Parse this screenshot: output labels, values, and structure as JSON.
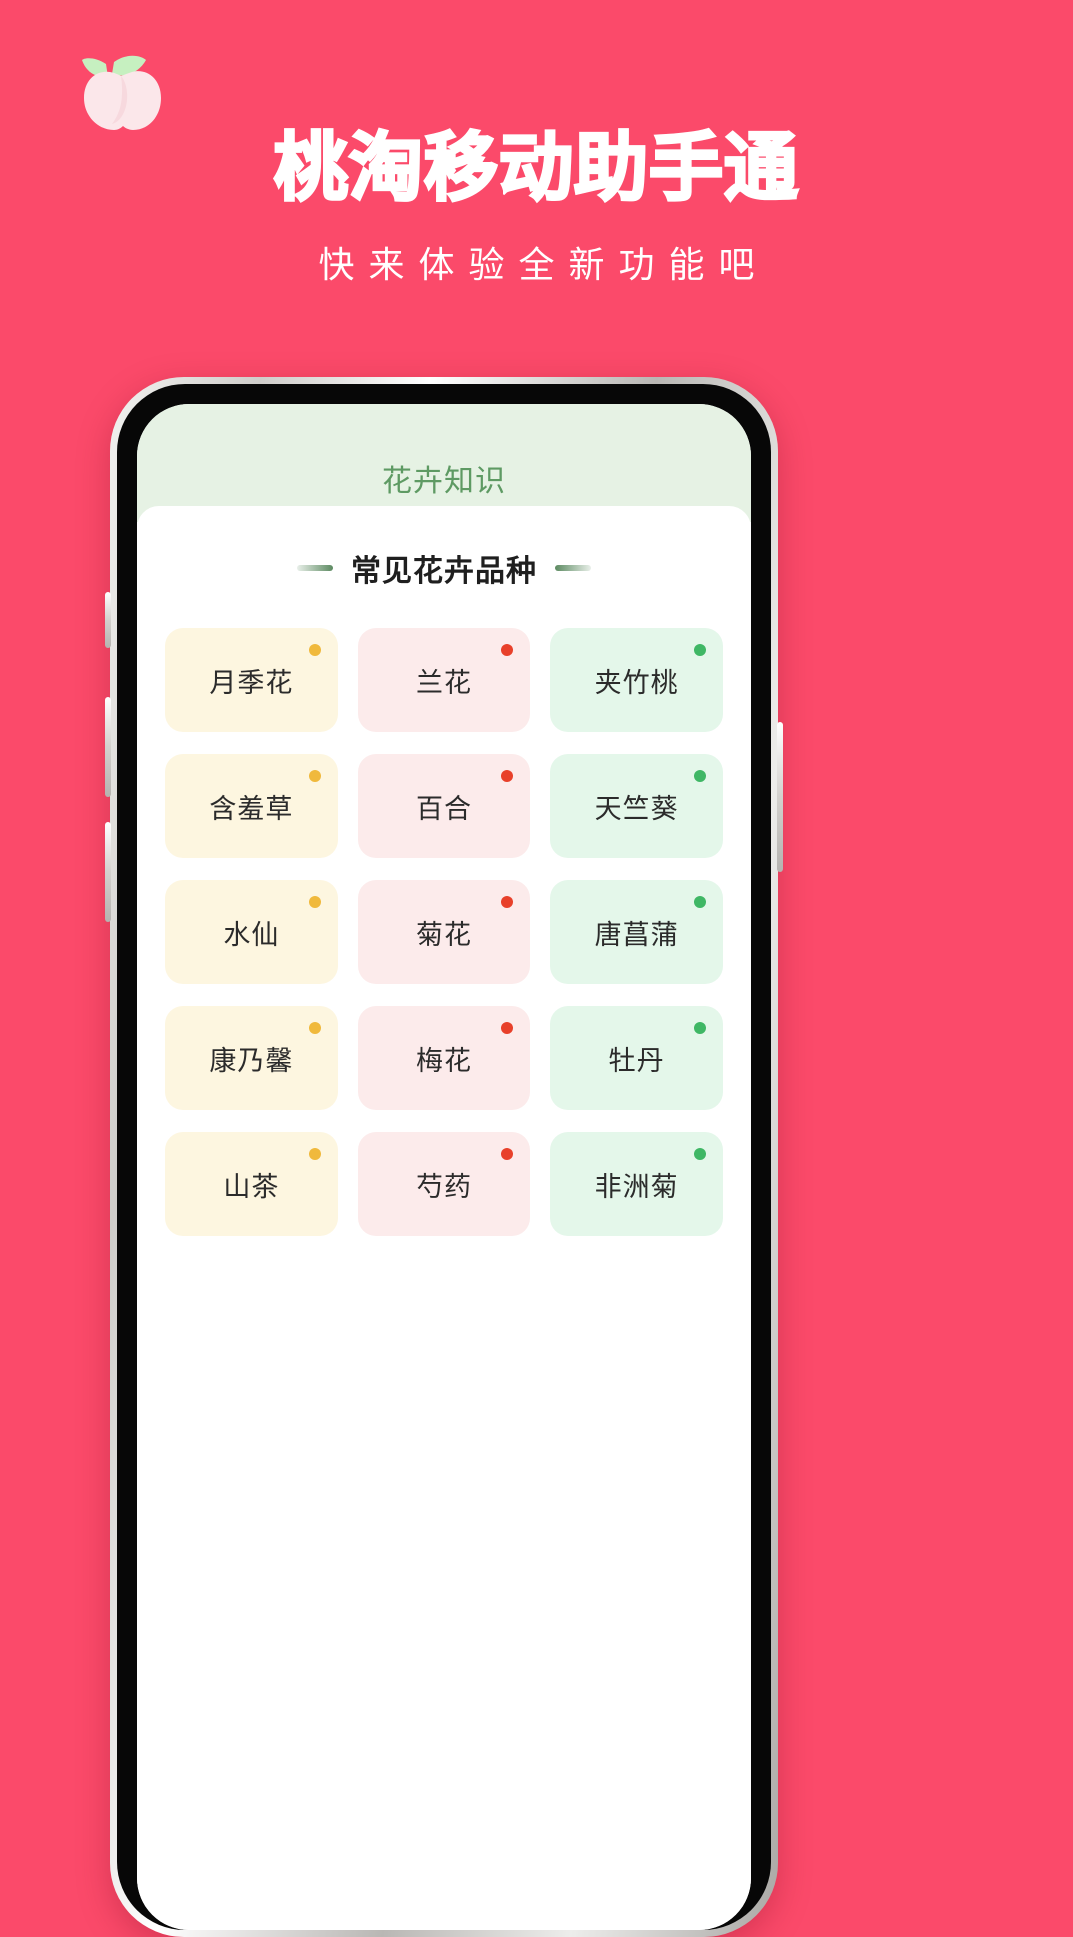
{
  "promo": {
    "logo_icon": "peach-icon",
    "title": "桃淘移动助手通",
    "subtitle": "快来体验全新功能吧",
    "background_color": "#FB4A6A",
    "title_color": "#FFFFFF"
  },
  "app": {
    "header": {
      "title": "花卉知识",
      "background_color": "#E6F2E4",
      "title_color": "#5E9A63"
    },
    "section": {
      "title": "常见花卉品种",
      "dash_color": "#5C8A61"
    },
    "palette": {
      "cream_card": "#FDF6E0",
      "pink_card": "#FCEBEB",
      "green_card": "#E4F7EA",
      "amber_dot": "#F0B93C",
      "red_dot": "#E8402A",
      "green_dot": "#3FB765"
    },
    "flower_cards": [
      {
        "label": "月季花",
        "style": "cream",
        "dot": "amber"
      },
      {
        "label": "兰花",
        "style": "pink",
        "dot": "red"
      },
      {
        "label": "夹竹桃",
        "style": "green",
        "dot": "green"
      },
      {
        "label": "含羞草",
        "style": "cream",
        "dot": "amber"
      },
      {
        "label": "百合",
        "style": "pink",
        "dot": "red"
      },
      {
        "label": "天竺葵",
        "style": "green",
        "dot": "green"
      },
      {
        "label": "水仙",
        "style": "cream",
        "dot": "amber"
      },
      {
        "label": "菊花",
        "style": "pink",
        "dot": "red"
      },
      {
        "label": "唐菖蒲",
        "style": "green",
        "dot": "green"
      },
      {
        "label": "康乃馨",
        "style": "cream",
        "dot": "amber"
      },
      {
        "label": "梅花",
        "style": "pink",
        "dot": "red"
      },
      {
        "label": "牡丹",
        "style": "green",
        "dot": "green"
      },
      {
        "label": "山茶",
        "style": "cream",
        "dot": "amber"
      },
      {
        "label": "芍药",
        "style": "pink",
        "dot": "red"
      },
      {
        "label": "非洲菊",
        "style": "green",
        "dot": "green"
      }
    ]
  }
}
